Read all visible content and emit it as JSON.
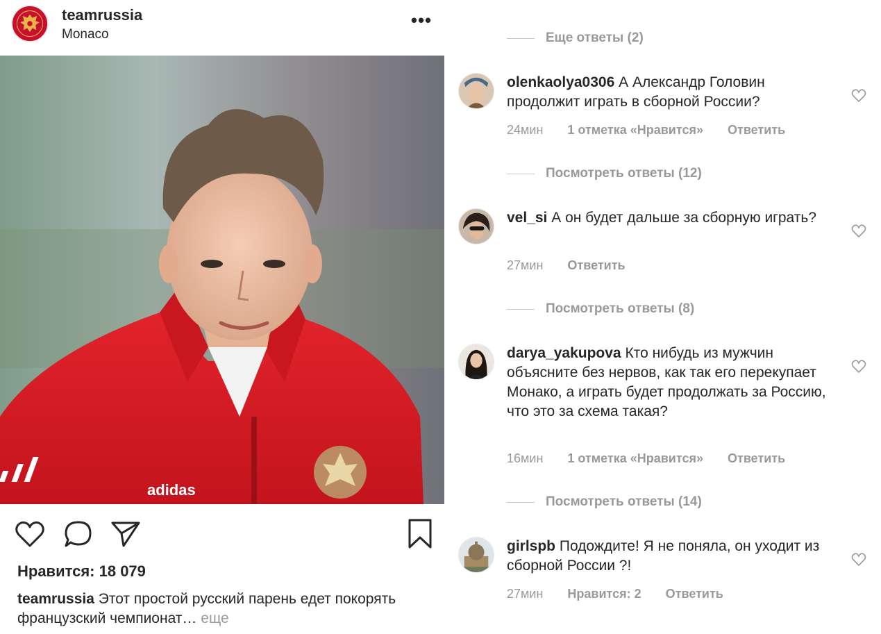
{
  "post": {
    "username": "teamrussia",
    "location": "Monaco",
    "more_label": "•••",
    "likes_text": "Нравится: 18 079",
    "caption_user": "teamrussia",
    "caption_text": "Этот простой русский парень едет покорять французский чемпионат…",
    "caption_more": "еще",
    "photo_jersey_brand": "adidas"
  },
  "comments": {
    "top_reply_link": "Еще ответы (2)",
    "items": [
      {
        "user": "olenkaolya0306",
        "text": "А Александр Головин продолжит играть в сборной России?",
        "time": "24мин",
        "likes": "1 отметка «Нравится»",
        "reply": "Ответить",
        "replies_link": "Посмотреть ответы (12)"
      },
      {
        "user": "vel_si",
        "text": "А он будет дальше за сборную играть?",
        "time": "27мин",
        "likes": "",
        "reply": "Ответить",
        "replies_link": "Посмотреть ответы (8)"
      },
      {
        "user": "darya_yakupova",
        "text": "Кто нибудь из мужчин объясните без нервов, как так его перекупает Монако, а играть будет продолжать за Россию, что это за схема такая?",
        "time": "16мин",
        "likes": "1 отметка «Нравится»",
        "reply": "Ответить",
        "replies_link": "Посмотреть ответы (14)"
      },
      {
        "user": "girlspb",
        "text": "Подождите! Я не поняла, он уходит из сборной России ?!",
        "time": "27мин",
        "likes": "Нравится: 2",
        "reply": "Ответить",
        "replies_link": ""
      }
    ]
  },
  "icons": {
    "like": "heart-icon",
    "comment": "comment-bubble-icon",
    "share": "paper-plane-icon",
    "save": "bookmark-icon",
    "comment_like": "small-heart-icon"
  },
  "colors": {
    "text": "#262626",
    "muted": "#999999",
    "jersey_red": "#d81f26",
    "avatar_red": "#c8102e"
  }
}
